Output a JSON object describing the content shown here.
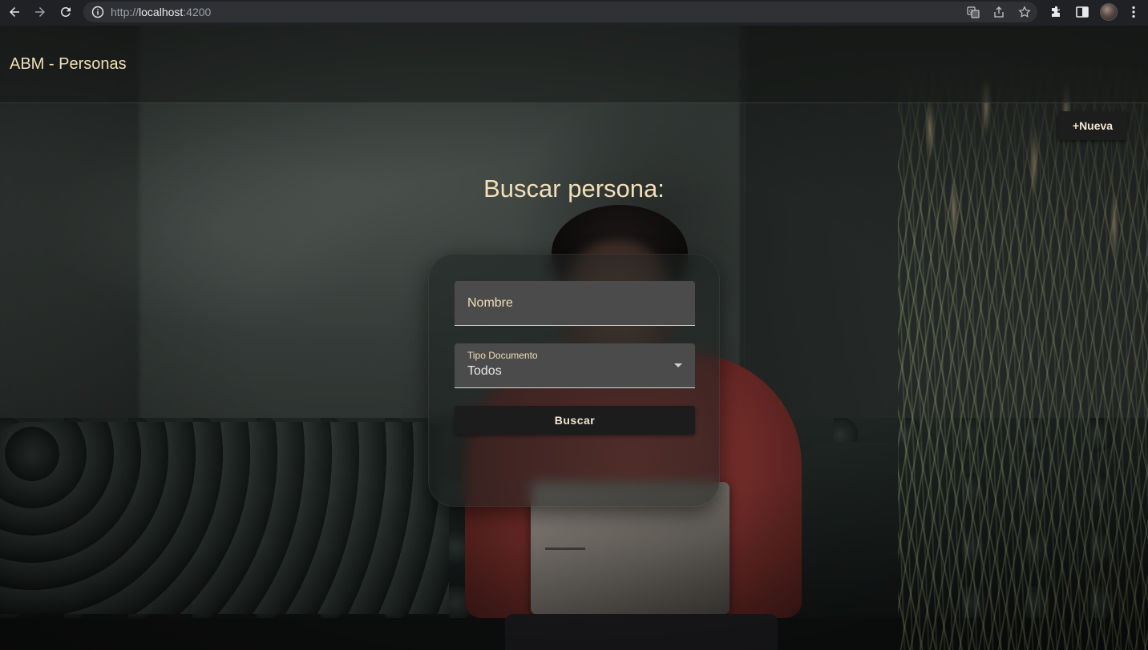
{
  "browser": {
    "url_scheme": "http://",
    "url_host": "localhost",
    "url_port": ":4200",
    "icons": [
      "back-icon",
      "forward-icon",
      "reload-icon",
      "info-icon",
      "translate-icon",
      "share-icon",
      "bookmark-star-icon",
      "extensions-icon",
      "side-panel-icon",
      "profile-avatar",
      "kebab-menu-icon"
    ]
  },
  "app": {
    "title": "ABM - Personas",
    "new_button_label": "+Nueva"
  },
  "search": {
    "heading": "Buscar persona:",
    "nombre_placeholder": "Nombre",
    "tipo_documento_label": "Tipo Documento",
    "tipo_documento_value": "Todos",
    "submit_label": "Buscar"
  },
  "colors": {
    "accent_text": "#f2dfb8",
    "field_bg": "#4b4b4b",
    "button_bg": "#1c1c1c"
  }
}
